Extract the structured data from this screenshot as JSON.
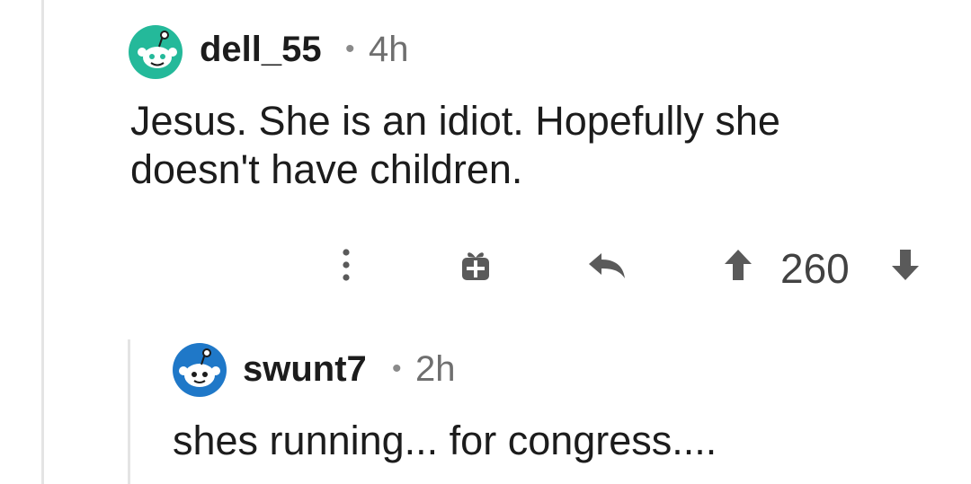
{
  "comment": {
    "author": "dell_55",
    "separator": "•",
    "time": "4h",
    "body_lines": [
      "Jesus. She is an idiot. Hopefully she",
      "doesn't have children."
    ],
    "score": "260",
    "avatar_color": "#24b99a",
    "icons": [
      "snoo-avatar-icon",
      "more-options-icon",
      "gift-award-icon",
      "reply-icon",
      "upvote-icon",
      "downvote-icon"
    ]
  },
  "reply": {
    "author": "swunt7",
    "separator": "•",
    "time": "2h",
    "body": "shes running... for congress....",
    "avatar_color": "#1f78c8"
  },
  "colors": {
    "text": "#1c1c1c",
    "muted": "#6f6f6f",
    "icon": "#5a5a5a",
    "thread_line": "#e4e4e4"
  }
}
